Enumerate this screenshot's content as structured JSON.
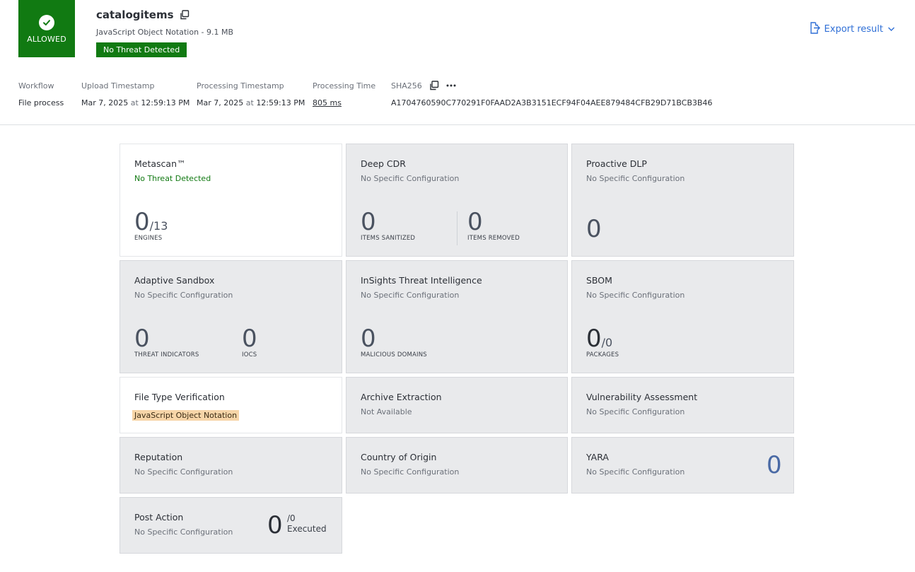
{
  "header": {
    "verdict": "ALLOWED",
    "file_name": "catalogitems",
    "file_info": "JavaScript Object Notation - 9.1 MB",
    "threat_badge": "No Threat Detected",
    "export_label": "Export result"
  },
  "meta": {
    "workflow": {
      "label": "Workflow",
      "value": "File process"
    },
    "upload": {
      "label": "Upload Timestamp",
      "date": "Mar 7, 2025",
      "at": "at",
      "time": "12:59:13 PM"
    },
    "processing": {
      "label": "Processing Timestamp",
      "date": "Mar 7, 2025",
      "at": "at",
      "time": "12:59:13 PM"
    },
    "processing_time": {
      "label": "Processing Time",
      "value": "805 ms"
    },
    "sha256": {
      "label": "SHA256",
      "value": "A1704760590C770291F0FAAD2A3B3151ECF94F04AEE879484CFB29D71BCB3B46"
    }
  },
  "cards": {
    "metascan": {
      "title": "Metascan™",
      "status": "No Threat Detected",
      "count": "0",
      "total": "/13",
      "caption": "ENGINES"
    },
    "deep_cdr": {
      "title": "Deep CDR",
      "status": "No Specific Configuration",
      "sanitized": "0",
      "sanitized_caption": "ITEMS SANITIZED",
      "removed": "0",
      "removed_caption": "ITEMS REMOVED"
    },
    "proactive_dlp": {
      "title": "Proactive DLP",
      "status": "No Specific Configuration",
      "count": "0"
    },
    "sandbox": {
      "title": "Adaptive Sandbox",
      "status": "No Specific Configuration",
      "threats": "0",
      "threats_caption": "THREAT INDICATORS",
      "iocs": "0",
      "iocs_caption": "IOCS"
    },
    "insights": {
      "title": "InSights Threat Intelligence",
      "status": "No Specific Configuration",
      "domains": "0",
      "domains_caption": "MALICIOUS DOMAINS"
    },
    "sbom": {
      "title": "SBOM",
      "status": "No Specific Configuration",
      "count": "0",
      "total": "/0",
      "caption": "PACKAGES"
    },
    "file_type": {
      "title": "File Type Verification",
      "status": "JavaScript Object Notation"
    },
    "archive": {
      "title": "Archive Extraction",
      "status": "Not Available"
    },
    "vulnerability": {
      "title": "Vulnerability Assessment",
      "status": "No Specific Configuration"
    },
    "reputation": {
      "title": "Reputation",
      "status": "No Specific Configuration"
    },
    "country": {
      "title": "Country of Origin",
      "status": "No Specific Configuration"
    },
    "yara": {
      "title": "YARA",
      "status": "No Specific Configuration",
      "count": "0"
    },
    "post_action": {
      "title": "Post Action",
      "status": "No Specific Configuration",
      "count": "0",
      "total": "/0",
      "caption": "Executed"
    }
  },
  "colors": {
    "allowed_green": "#117a12",
    "link_blue": "#2f6fd6",
    "highlight": "#f7d5a8",
    "card_gray": "#e9eaec"
  },
  "icons": [
    "check-icon",
    "copy-icon",
    "export-file-icon",
    "chevron-down-icon",
    "more-icon"
  ]
}
